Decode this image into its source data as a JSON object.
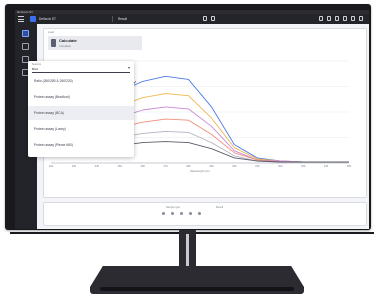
{
  "window": {
    "title": "DeNovix ST"
  },
  "header": {
    "file_name": "DeNovix ST",
    "button_label": "Result",
    "icons": [
      "menu-icon",
      "logo-icon",
      "play-icon",
      "sync-icon",
      "settings-icon",
      "search-icon",
      "lock-icon",
      "edit-icon",
      "bell-icon",
      "help-icon"
    ]
  },
  "sidebar": {
    "items": [
      {
        "icon": "dashboard-icon",
        "active": true
      },
      {
        "icon": "grid-icon",
        "active": false
      },
      {
        "icon": "check-icon",
        "active": false
      },
      {
        "icon": "document-icon",
        "active": false
      }
    ]
  },
  "card": {
    "label": "Load",
    "title": "Calculate",
    "subtitle": "Complete",
    "colors": {
      "accent": "#3c6ff0",
      "surface": "#ffffff"
    }
  },
  "dropdown": {
    "label": "Selector",
    "value": "BCA",
    "caret": "▾",
    "check": "✓",
    "items": [
      {
        "label": "Ratio (260/280 & 260/230)",
        "selected": false
      },
      {
        "label": "Protein assay (Bradford)",
        "selected": false
      },
      {
        "label": "Protein assay (BCA)",
        "selected": true
      },
      {
        "label": "Protein assay (Lowry)",
        "selected": false
      },
      {
        "label": "Protein assay (Pierce 660)",
        "selected": false
      }
    ]
  },
  "chart_data": {
    "type": "line",
    "title": "",
    "xlabel": "Wavelength (nm)",
    "ylabel": "",
    "x": [
      220,
      230,
      240,
      250,
      260,
      270,
      280,
      290,
      300,
      310,
      320,
      330,
      340,
      350
    ],
    "xticks": [
      "220",
      "230",
      "240",
      "250",
      "260",
      "270",
      "280",
      "290",
      "300",
      "310",
      "320",
      "330",
      "340",
      "350"
    ],
    "ylim": [
      0,
      1.0
    ],
    "grid": true,
    "series": [
      {
        "color": "#4a7bea",
        "values": [
          0.5,
          0.56,
          0.62,
          0.7,
          0.8,
          0.85,
          0.82,
          0.55,
          0.18,
          0.05,
          0.02,
          0.01,
          0.01,
          0.01
        ]
      },
      {
        "color": "#f0b84a",
        "values": [
          0.4,
          0.45,
          0.5,
          0.56,
          0.64,
          0.68,
          0.66,
          0.44,
          0.15,
          0.04,
          0.02,
          0.01,
          0.01,
          0.01
        ]
      },
      {
        "color": "#c98ad4",
        "values": [
          0.32,
          0.36,
          0.4,
          0.45,
          0.52,
          0.55,
          0.53,
          0.36,
          0.12,
          0.03,
          0.02,
          0.01,
          0.01,
          0.01
        ]
      },
      {
        "color": "#f08f7a",
        "values": [
          0.25,
          0.28,
          0.31,
          0.35,
          0.4,
          0.43,
          0.42,
          0.28,
          0.1,
          0.03,
          0.01,
          0.01,
          0.01,
          0.01
        ]
      },
      {
        "color": "#b0b3c0",
        "values": [
          0.18,
          0.2,
          0.22,
          0.25,
          0.29,
          0.31,
          0.3,
          0.2,
          0.07,
          0.02,
          0.01,
          0.01,
          0.01,
          0.01
        ]
      },
      {
        "color": "#5a5d6a",
        "values": [
          0.12,
          0.13,
          0.15,
          0.17,
          0.2,
          0.21,
          0.2,
          0.14,
          0.05,
          0.02,
          0.01,
          0.01,
          0.01,
          0.01
        ]
      }
    ]
  },
  "footer": {
    "label_a": "Sample type",
    "label_b": "Result"
  }
}
